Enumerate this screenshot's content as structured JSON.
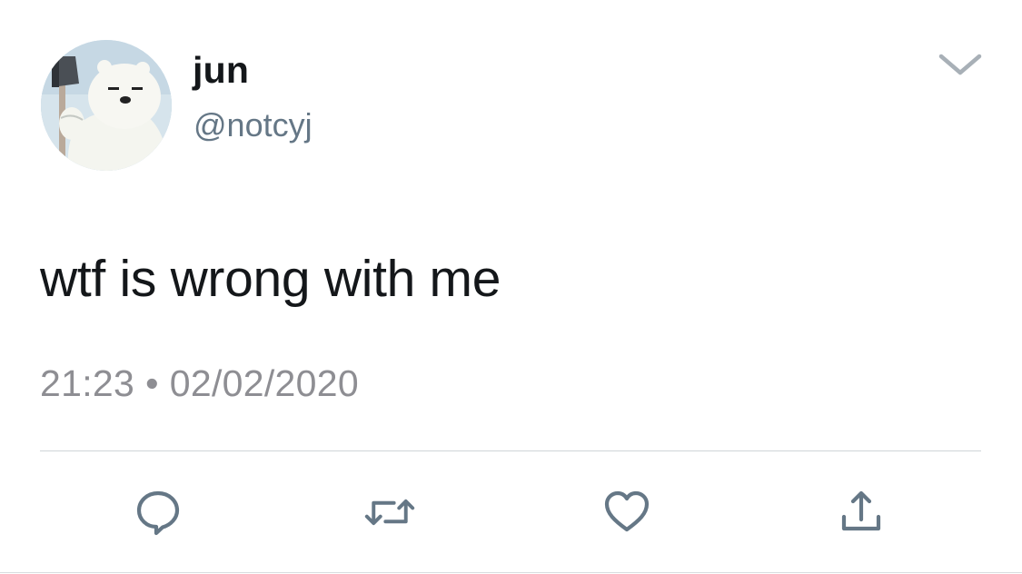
{
  "tweet": {
    "display_name": "jun",
    "handle": "@notcyj",
    "text": "wtf is wrong with me",
    "time": "21:23",
    "separator": "•",
    "date": "02/02/2020"
  },
  "icons": {
    "menu": "chevron-down-icon",
    "reply": "reply-icon",
    "retweet": "retweet-icon",
    "like": "heart-icon",
    "share": "share-icon"
  },
  "colors": {
    "text": "#14171a",
    "secondary": "#657786",
    "icon": "#657786",
    "divider": "#cfd4d8"
  }
}
